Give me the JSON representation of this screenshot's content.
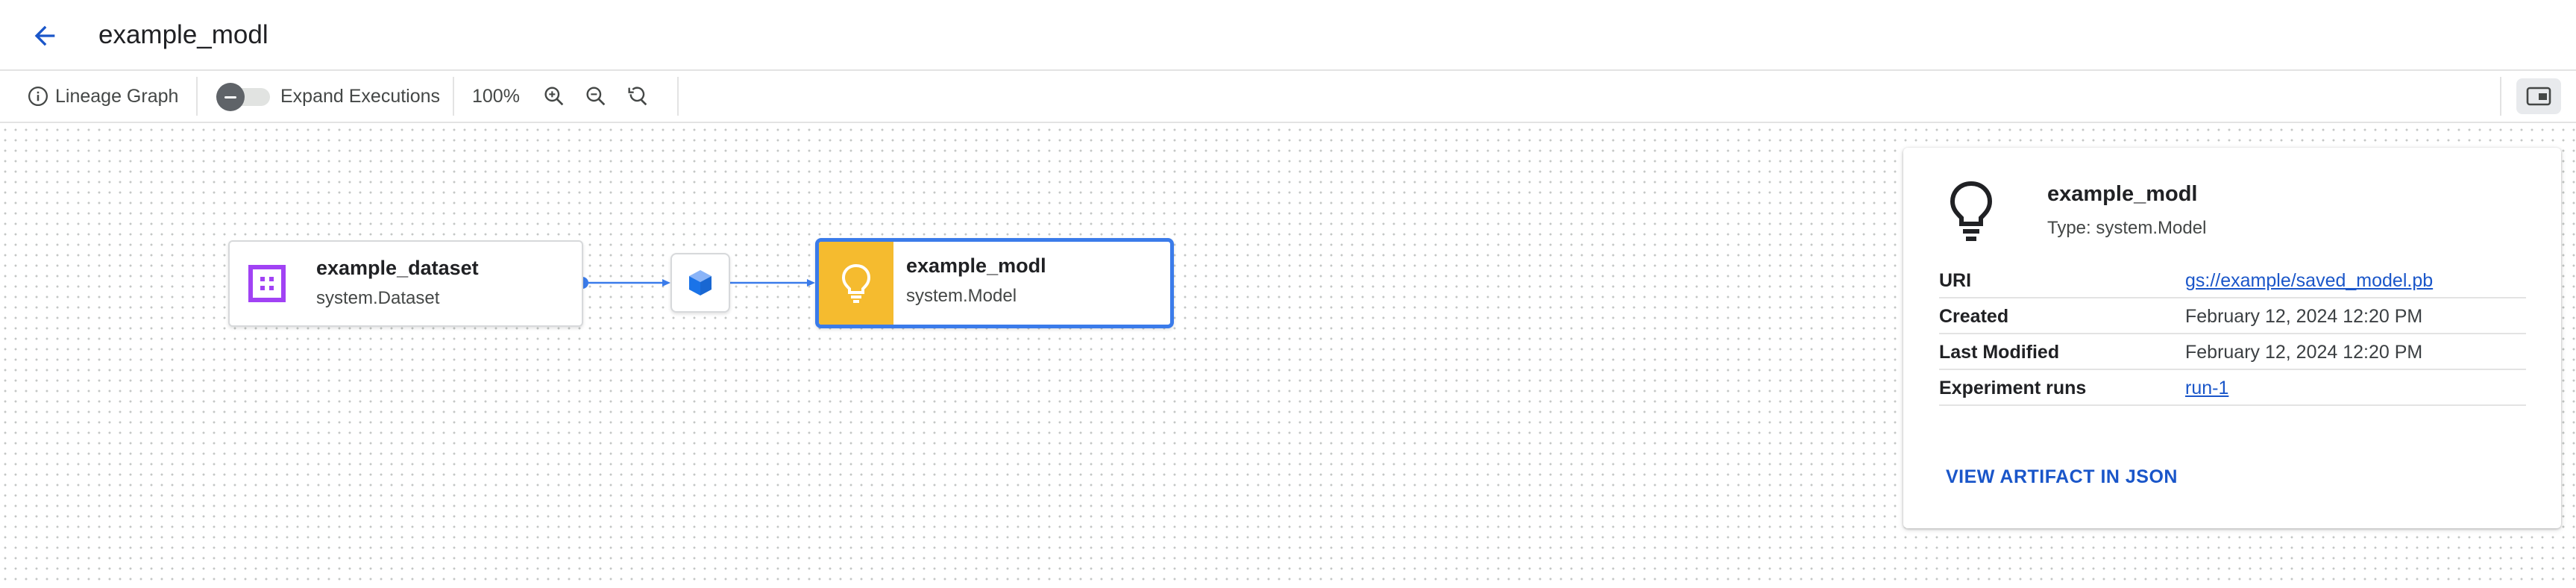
{
  "header": {
    "title": "example_modl",
    "back_icon": "arrow-back-icon"
  },
  "toolbar": {
    "lineage_label": "Lineage Graph",
    "expand_label": "Expand Executions",
    "expand_on": false,
    "zoom_level": "100%",
    "icons": [
      "info-icon",
      "zoom-in-icon",
      "zoom-out-icon",
      "zoom-reset-icon",
      "side-panel-icon"
    ]
  },
  "graph": {
    "nodes": [
      {
        "title": "example_dataset",
        "subtitle": "system.Dataset",
        "icon": "dataset-icon",
        "icon_color": "#a142f4"
      },
      {
        "title": "example_modl",
        "subtitle": "system.Model",
        "icon": "lightbulb-icon",
        "icon_bg": "#f5bb2f",
        "selected": true
      }
    ],
    "execution_icon": "execution-cube-icon",
    "edge_color": "#3a7bea"
  },
  "detail": {
    "title": "example_modl",
    "type": "Type: system.Model",
    "rows": [
      {
        "label": "URI",
        "value": "gs://example/saved_model.pb",
        "is_link": true
      },
      {
        "label": "Created",
        "value": "February 12, 2024 12:20 PM",
        "is_link": false
      },
      {
        "label": "Last Modified",
        "value": "February 12, 2024 12:20 PM",
        "is_link": false
      },
      {
        "label": "Experiment runs",
        "value": "run-1",
        "is_link": true
      }
    ],
    "action_label": "VIEW ARTIFACT IN JSON"
  },
  "colors": {
    "accent": "#1a56c9",
    "selected_border": "#3a7bea",
    "model_icon_bg": "#f5bb2f",
    "dataset_icon": "#a142f4",
    "execution_icon": "#1a73e8"
  }
}
